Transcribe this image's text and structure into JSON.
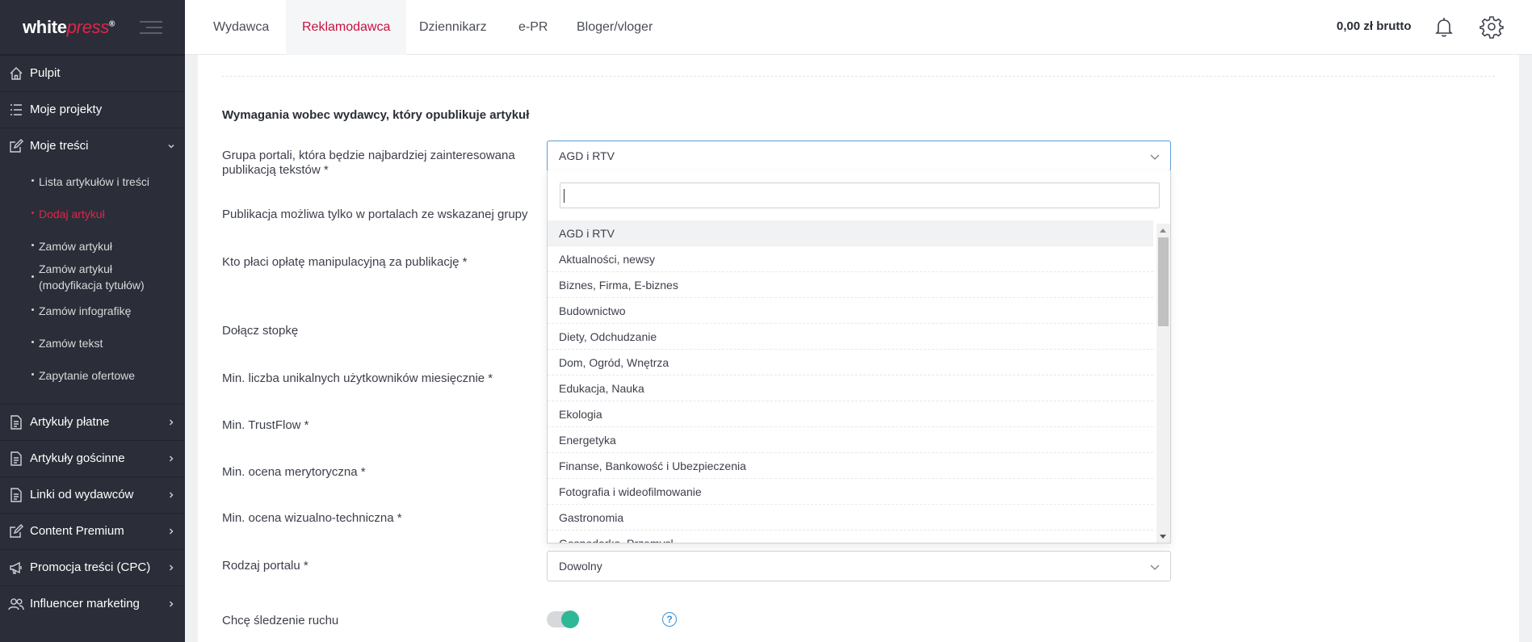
{
  "logo": {
    "white": "white",
    "press": "press",
    "reg": "®"
  },
  "sidebar": {
    "items": [
      {
        "label": "Pulpit",
        "icon": "home-icon"
      },
      {
        "label": "Moje projekty",
        "icon": "list-icon"
      },
      {
        "label": "Moje treści",
        "icon": "edit-icon"
      },
      {
        "label": "Artykuły płatne",
        "icon": "document-icon"
      },
      {
        "label": "Artykuły gościnne",
        "icon": "document-icon"
      },
      {
        "label": "Linki od wydawców",
        "icon": "document-icon"
      },
      {
        "label": "Content Premium",
        "icon": "edit-icon"
      },
      {
        "label": "Promocja treści (CPC)",
        "icon": "megaphone-icon"
      },
      {
        "label": "Influencer marketing",
        "icon": "users-icon"
      }
    ],
    "subitems": [
      {
        "label": "Lista artykułów i treści"
      },
      {
        "label": "Dodaj artykuł"
      },
      {
        "label": "Zamów artykuł"
      },
      {
        "label": "Zamów artykuł (modyfikacja tytułów)"
      },
      {
        "label": "Zamów infografikę"
      },
      {
        "label": "Zamów tekst"
      },
      {
        "label": "Zapytanie ofertowe"
      }
    ]
  },
  "topbar": {
    "tabs": [
      "Wydawca",
      "Reklamodawca",
      "Dziennikarz",
      "e-PR",
      "Bloger/vloger"
    ],
    "balance": "0,00 zł brutto"
  },
  "form": {
    "section_title": "Wymagania wobec wydawcy, który opublikuje artykuł",
    "labels": {
      "portal_group": "Grupa portali, która będzie najbardziej zainteresowana publikacją tekstów *",
      "only_group": "Publikacja możliwa tylko w portalach ze wskazanej grupy",
      "who_pays": "Kto płaci opłatę manipulacyjną za publikację *",
      "footer": "Dołącz stopkę",
      "min_users": "Min. liczba unikalnych użytkowników miesięcznie *",
      "min_trustflow": "Min. TrustFlow *",
      "min_merit": "Min. ocena merytoryczna *",
      "min_visual": "Min. ocena wizualno-techniczna *",
      "portal_type": "Rodzaj portalu *",
      "tracking": "Chcę śledzenie ruchu"
    },
    "portal_group_value": "AGD i RTV",
    "portal_type_value": "Dowolny",
    "tracking_enabled": true,
    "help": "?"
  },
  "dropdown": {
    "search_value": "",
    "options": [
      "AGD i RTV",
      "Aktualności, newsy",
      "Biznes, Firma, E-biznes",
      "Budownictwo",
      "Diety, Odchudzanie",
      "Dom, Ogród, Wnętrza",
      "Edukacja, Nauka",
      "Ekologia",
      "Energetyka",
      "Finanse, Bankowość i Ubezpieczenia",
      "Fotografia i wideofilmowanie",
      "Gastronomia",
      "Gospodarka, Przemysł"
    ],
    "selected_index": 0
  },
  "colors": {
    "accent": "#c8103e",
    "sidebar_bg": "#2b2e38",
    "toggle_on": "#2fb896",
    "link_blue": "#3a8fd6"
  }
}
